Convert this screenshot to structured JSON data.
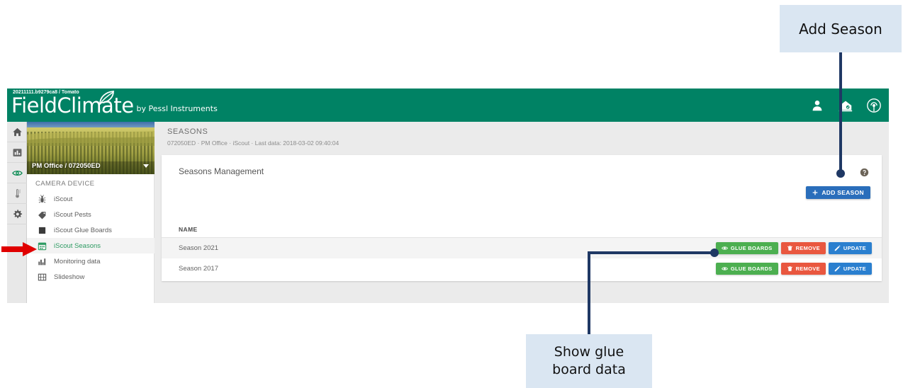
{
  "app": {
    "version_text": "20211111.b9279ca8 / Tomato",
    "brand_name": "FieldClimate",
    "brand_sub": "by Pessl Instruments",
    "header_green": "#008264",
    "header_icons": [
      {
        "name": "user-icon"
      },
      {
        "name": "station-icon"
      },
      {
        "name": "signal-icon"
      }
    ]
  },
  "icon_rail": [
    {
      "name": "home-icon",
      "active": false
    },
    {
      "name": "chart-icon",
      "active": false
    },
    {
      "name": "eye-icon",
      "active": true
    },
    {
      "name": "weather-icon",
      "active": false
    },
    {
      "name": "gear-icon",
      "active": false
    }
  ],
  "sidebar": {
    "device_label": "PM Office / 072050ED",
    "heading": "CAMERA DEVICE",
    "items": [
      {
        "label": "iScout",
        "icon": "insect-icon",
        "active": false
      },
      {
        "label": "iScout Pests",
        "icon": "tag-icon",
        "active": false
      },
      {
        "label": "iScout Glue Boards",
        "icon": "square-icon",
        "active": false
      },
      {
        "label": "iScout Seasons",
        "icon": "calendar-icon",
        "active": true
      },
      {
        "label": "Monitoring data",
        "icon": "bar-chart-icon",
        "active": false
      },
      {
        "label": "Slideshow",
        "icon": "filmstrip-icon",
        "active": false
      }
    ]
  },
  "main": {
    "page_title": "SEASONS",
    "breadcrumb": "072050ED · PM Office · iScout · Last data: 2018-03-02 09:40:04",
    "card_title": "Seasons Management",
    "help_icon": "help-icon",
    "add_season_label": "ADD SEASON",
    "add_season_color": "#2a6ebb",
    "columns": [
      "NAME"
    ],
    "rows": [
      {
        "name": "Season 2021",
        "actions": [
          {
            "label": "GLUE BOARDS",
            "icon": "eye-icon",
            "color": "#4caf50"
          },
          {
            "label": "REMOVE",
            "icon": "trash-icon",
            "color": "#e9573f"
          },
          {
            "label": "UPDATE",
            "icon": "pencil-icon",
            "color": "#2a7fcf"
          }
        ]
      },
      {
        "name": "Season 2017",
        "actions": [
          {
            "label": "GLUE BOARDS",
            "icon": "eye-icon",
            "color": "#4caf50"
          },
          {
            "label": "REMOVE",
            "icon": "trash-icon",
            "color": "#e9573f"
          },
          {
            "label": "UPDATE",
            "icon": "pencil-icon",
            "color": "#2a7fcf"
          }
        ]
      }
    ]
  },
  "annotations": {
    "callout_add_season": "Add Season",
    "callout_glue_line1": "Show glue",
    "callout_glue_line2": "board data",
    "callout_bg": "#dae6f2",
    "connector_color": "#1f3864",
    "arrow_color": "#e00000",
    "arrow_target": "iScout Seasons"
  }
}
